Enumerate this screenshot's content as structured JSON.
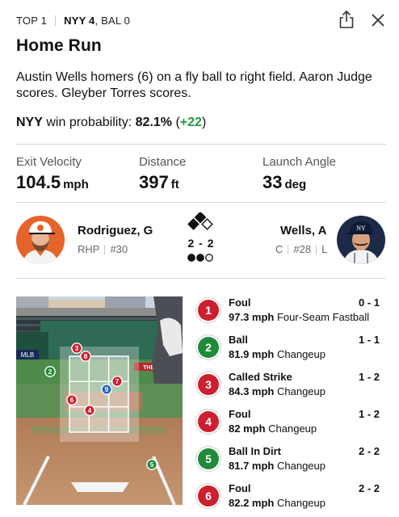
{
  "header": {
    "inning": "TOP 1",
    "lead_team_score": "NYY 4",
    "trail_team_score": ", BAL 0"
  },
  "play": {
    "title": "Home Run",
    "description": "Austin Wells homers (6) on a fly ball to right field. Aaron Judge scores. Gleyber Torres scores.",
    "win_probability": {
      "team": "NYY",
      "label": "win probability:",
      "value": "82.1%",
      "delta": "+22"
    }
  },
  "stats": [
    {
      "label": "Exit Velocity",
      "value": "104.5",
      "unit": "mph"
    },
    {
      "label": "Distance",
      "value": "397",
      "unit": "ft"
    },
    {
      "label": "Launch Angle",
      "value": "33",
      "unit": "deg"
    }
  ],
  "matchup": {
    "pitcher": {
      "name": "Rodriguez, G",
      "hand": "RHP",
      "number": "#30"
    },
    "batter": {
      "name": "Wells, A",
      "position": "C",
      "number": "#28",
      "bats": "L"
    },
    "count": "2 - 2",
    "outs": 2,
    "bases": {
      "first": false,
      "second": true,
      "third": true
    }
  },
  "pitches": [
    {
      "number": "1",
      "result": "Foul",
      "count": "0 - 1",
      "speed": "97.3 mph",
      "type": "Four-Seam Fastball",
      "color": "#cc1f2f"
    },
    {
      "number": "2",
      "result": "Ball",
      "count": "1 - 1",
      "speed": "81.9 mph",
      "type": "Changeup",
      "color": "#1e8a3a"
    },
    {
      "number": "3",
      "result": "Called Strike",
      "count": "1 - 2",
      "speed": "84.3 mph",
      "type": "Changeup",
      "color": "#cc1f2f"
    },
    {
      "number": "4",
      "result": "Foul",
      "count": "1 - 2",
      "speed": "82 mph",
      "type": "Changeup",
      "color": "#cc1f2f"
    },
    {
      "number": "5",
      "result": "Ball In Dirt",
      "count": "2 - 2",
      "speed": "81.7 mph",
      "type": "Changeup",
      "color": "#1e8a3a"
    },
    {
      "number": "6",
      "result": "Foul",
      "count": "2 - 2",
      "speed": "82.2 mph",
      "type": "Changeup",
      "color": "#cc1f2f"
    }
  ],
  "zone_markers": [
    {
      "label": "3",
      "color": "#cc1f2f"
    },
    {
      "label": "8",
      "color": "#cc1f2f"
    },
    {
      "label": "2",
      "color": "#1e8a3a"
    },
    {
      "label": "7",
      "color": "#cc1f2f"
    },
    {
      "label": "9",
      "color": "#2a63c9"
    },
    {
      "label": "6",
      "color": "#cc1f2f"
    },
    {
      "label": "4",
      "color": "#cc1f2f"
    },
    {
      "label": "5",
      "color": "#1e8a3a"
    }
  ],
  "scene_text": {
    "board": "MLB",
    "sign": "THE SHOW"
  },
  "colors": {
    "positive": "#1e9a3e",
    "strike": "#cc1f2f",
    "ball": "#1e8a3a",
    "in_play": "#2a63c9"
  },
  "icons": [
    "share-icon",
    "close-icon",
    "bases-diamond-icon",
    "outs-dots-icon"
  ]
}
